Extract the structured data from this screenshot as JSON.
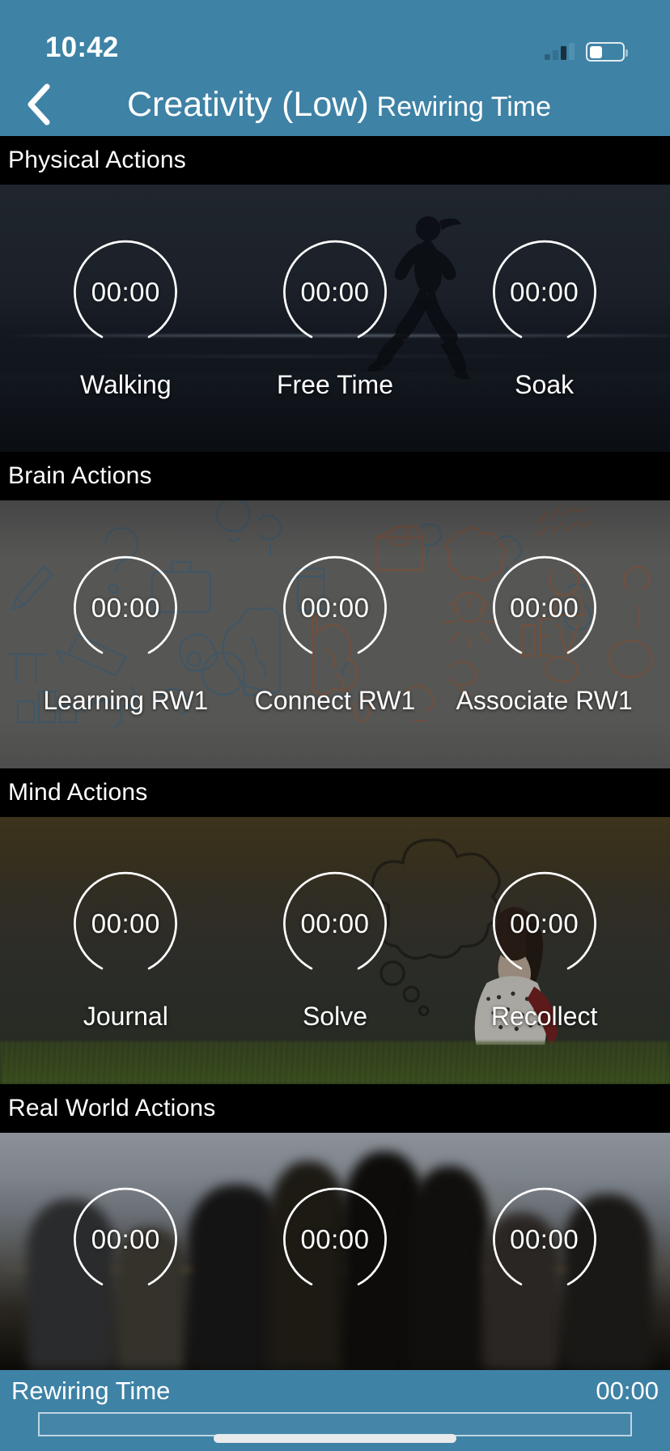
{
  "status_bar": {
    "time": "10:42",
    "signal_icon": "cellular-bars-icon",
    "battery_icon": "battery-icon",
    "battery_level_pct": 40
  },
  "nav": {
    "back_icon": "chevron-left-icon",
    "title_main": "Creativity (Low)",
    "title_sub": "Rewiring Time"
  },
  "theme": {
    "accent": "#3E82A5",
    "section_header_bg": "#000000",
    "text": "#FFFFFF"
  },
  "sections": [
    {
      "header": "Physical Actions",
      "background": "beach-runner-photo",
      "tiles": [
        {
          "time": "00:00",
          "label": "Walking"
        },
        {
          "time": "00:00",
          "label": "Free Time"
        },
        {
          "time": "00:00",
          "label": "Soak"
        }
      ]
    },
    {
      "header": "Brain Actions",
      "background": "creative-doodles-illustration",
      "tiles": [
        {
          "time": "00:00",
          "label": "Learning RW1"
        },
        {
          "time": "00:00",
          "label": "Connect RW1"
        },
        {
          "time": "00:00",
          "label": "Associate RW1"
        }
      ]
    },
    {
      "header": "Mind Actions",
      "background": "girl-thinking-field-photo",
      "tiles": [
        {
          "time": "00:00",
          "label": "Journal"
        },
        {
          "time": "00:00",
          "label": "Solve"
        },
        {
          "time": "00:00",
          "label": "Recollect"
        }
      ]
    },
    {
      "header": "Real World Actions",
      "background": "blurred-crowd-photo",
      "tiles": [
        {
          "time": "00:00",
          "label": ""
        },
        {
          "time": "00:00",
          "label": ""
        },
        {
          "time": "00:00",
          "label": ""
        }
      ]
    }
  ],
  "bottom_bar": {
    "label": "Rewiring Time",
    "value": "00:00",
    "progress_pct": 0
  }
}
